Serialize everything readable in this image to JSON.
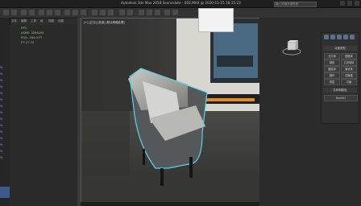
{
  "titlebar": {
    "title": "Autodesk 3ds Max 2018    Sceneslate - 002.MAX @ 2020-11-15 18:15:23",
    "search_placeholder": "键入关键字或短语"
  },
  "menubar": {
    "items": [
      "文件",
      "编辑",
      "工具",
      "组",
      "视图",
      "创建",
      "修改器",
      "动画",
      "图形编辑器",
      "渲染",
      "自定义",
      "脚本",
      "内容",
      "帮助"
    ]
  },
  "outliner": {
    "lines": [
      "FPS:",
      "ASME: 3296200",
      "PO/L: 200.4 FT",
      "FT: 27.72"
    ]
  },
  "viewport": {
    "label": "[+] [正交] [标准] [默认明暗处理]"
  },
  "command_panel": {
    "header_object_type": "对象类型",
    "buttons": [
      "长方体",
      "圆锥体",
      "球体",
      "几何球体",
      "圆柱体",
      "管状体",
      "圆环",
      "四棱锥",
      "茶壶",
      "平面"
    ],
    "header_name_color": "名称和颜色",
    "name_field": "Box001"
  },
  "colors": {
    "accent": "#3d5a8a",
    "selection_outline": "#5fd3e6",
    "viewport_bg": "#3a3a38"
  }
}
